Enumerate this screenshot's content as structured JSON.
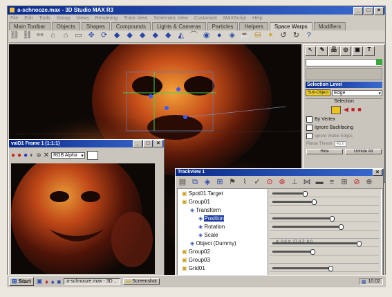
{
  "app_title": "a-schnooze.max - 3D Studio MAX R3",
  "menu": [
    "File",
    "Edit",
    "Tools",
    "Group",
    "Views",
    "Rendering",
    "Track View",
    "Schematic View",
    "Customize",
    "MAXScript",
    "Help"
  ],
  "tabs": [
    "Main Toolbar",
    "Objects",
    "Shapes",
    "Compounds",
    "Lights & Cameras",
    "Particles",
    "Helpers",
    "Space Warps",
    "Modifiers"
  ],
  "active_tab": "Space Warps",
  "render_window": {
    "title": "vaID1 Frame 1 (1:1:1)",
    "channel_select": "RGB Alpha"
  },
  "command_panel": {
    "selection_level_label": "Selection Level",
    "sub_object_button": "Sub-Object",
    "sub_object_value": "Edge",
    "selection_rollout": "Selection",
    "by_vertex": "By Vertex",
    "ignore_backfacing": "Ignore Backfacing",
    "ignore_visible_edges": "Ignore Visible Edges",
    "planar_thresh_label": "Planar Thresh",
    "planar_thresh_value": "45.0",
    "btn_hide": "Hide",
    "btn_unhide": "Unhide All"
  },
  "trackview": {
    "title": "Trackview 1",
    "tree": [
      {
        "label": "Spot01.Target",
        "indent": 0
      },
      {
        "label": "Group01",
        "indent": 0
      },
      {
        "label": "Transform",
        "indent": 1
      },
      {
        "label": "Position",
        "indent": 2
      },
      {
        "label": "Rotation",
        "indent": 2
      },
      {
        "label": "Scale",
        "indent": 2
      },
      {
        "label": "Object (Dummy)",
        "indent": 1
      },
      {
        "label": "Group02",
        "indent": 0
      },
      {
        "label": "Group03",
        "indent": 0
      },
      {
        "label": "Grid01",
        "indent": 0
      }
    ],
    "time_label": "X: 0.0  Y: 27.0  Z: 0.0"
  },
  "taskbar": {
    "start": "Start",
    "tasks": [
      "a-schnooze.max - 3D ...",
      "Screenshot"
    ],
    "clock": "10:02"
  }
}
